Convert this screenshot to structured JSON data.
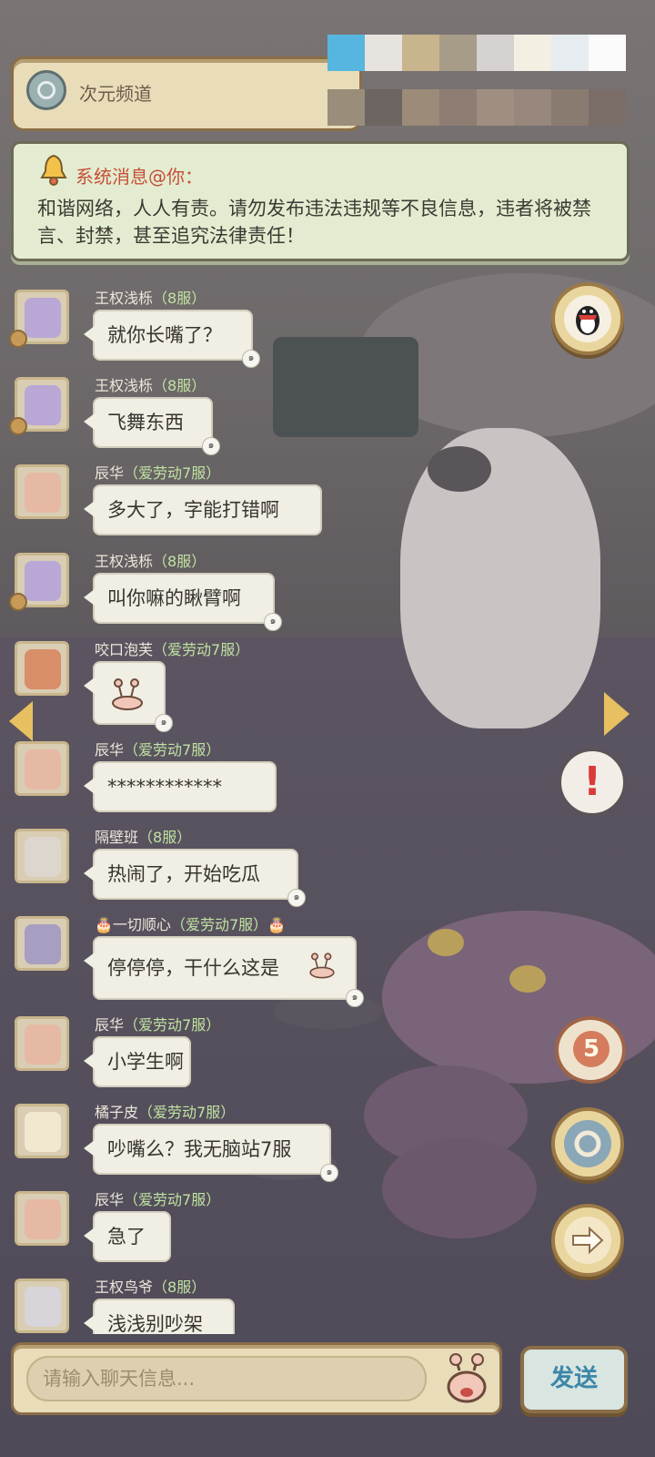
{
  "header": {
    "channel_name": "次元频道"
  },
  "system_message": {
    "title": "系统消息@你：",
    "body": "和谐网络，人人有责。请勿发布违法违规等不良信息，违者将被禁言、封禁，甚至追究法律责任！"
  },
  "messages": [
    {
      "name": "王权浅栎",
      "server": "（8服）",
      "text": "就你长嘴了？"
    },
    {
      "name": "王权浅栎",
      "server": "（8服）",
      "text": "飞舞东西"
    },
    {
      "name": "辰华",
      "server": "（爱劳动7服）",
      "text": "多大了，字能打错啊"
    },
    {
      "name": "王权浅栎",
      "server": "（8服）",
      "text": "叫你嘛的瞅臂啊"
    },
    {
      "name": "咬口泡芙",
      "server": "（爱劳动7服）",
      "text": ""
    },
    {
      "name": "辰华",
      "server": "（爱劳动7服）",
      "text": "************"
    },
    {
      "name": "隔壁班",
      "server": "（8服）",
      "text": "热闹了，开始吃瓜"
    },
    {
      "name": "一切顺心",
      "server": "（爱劳动7服）",
      "text": "停停停，干什么这是"
    },
    {
      "name": "辰华",
      "server": "（爱劳动7服）",
      "text": "小学生啊"
    },
    {
      "name": "橘子皮",
      "server": "（爱劳动7服）",
      "text": "吵嘴么？我无脑站7服"
    },
    {
      "name": "辰华",
      "server": "（爱劳动7服）",
      "text": "急了"
    },
    {
      "name": "王权鸟爷",
      "server": "（8服）",
      "text": "浅浅别吵架"
    }
  ],
  "side_buttons": {
    "unread_count": "5",
    "alert_mark": "!"
  },
  "input": {
    "placeholder": "请输入聊天信息...",
    "send_label": "发送"
  },
  "colors": {
    "server_tag": "#bfe3a0",
    "system_title": "#c64f37",
    "send_text": "#3c87a8"
  },
  "icons": [
    "ring-channel-icon",
    "bell-icon",
    "penguin-qq-icon",
    "ring-icon",
    "right-arrow-icon",
    "snail-emoji-icon",
    "left-arrow-icon",
    "alert-icon"
  ]
}
